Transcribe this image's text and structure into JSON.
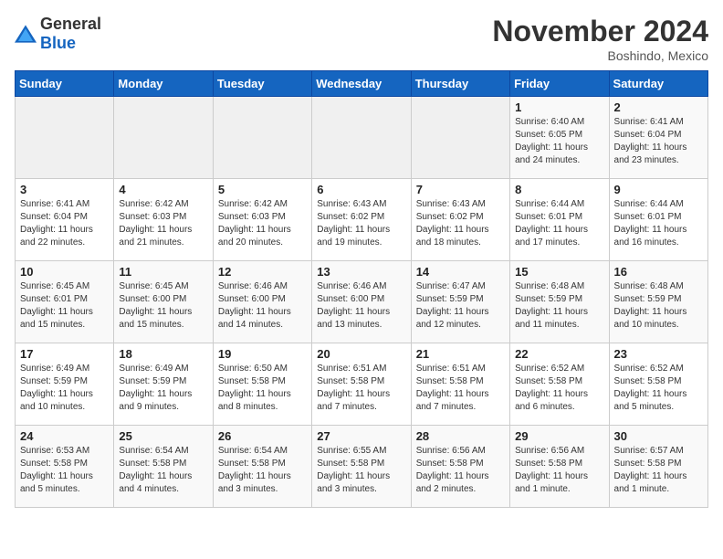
{
  "header": {
    "logo_general": "General",
    "logo_blue": "Blue",
    "month": "November 2024",
    "location": "Boshindo, Mexico"
  },
  "weekdays": [
    "Sunday",
    "Monday",
    "Tuesday",
    "Wednesday",
    "Thursday",
    "Friday",
    "Saturday"
  ],
  "weeks": [
    [
      {
        "day": "",
        "info": ""
      },
      {
        "day": "",
        "info": ""
      },
      {
        "day": "",
        "info": ""
      },
      {
        "day": "",
        "info": ""
      },
      {
        "day": "",
        "info": ""
      },
      {
        "day": "1",
        "info": "Sunrise: 6:40 AM\nSunset: 6:05 PM\nDaylight: 11 hours and 24 minutes."
      },
      {
        "day": "2",
        "info": "Sunrise: 6:41 AM\nSunset: 6:04 PM\nDaylight: 11 hours and 23 minutes."
      }
    ],
    [
      {
        "day": "3",
        "info": "Sunrise: 6:41 AM\nSunset: 6:04 PM\nDaylight: 11 hours and 22 minutes."
      },
      {
        "day": "4",
        "info": "Sunrise: 6:42 AM\nSunset: 6:03 PM\nDaylight: 11 hours and 21 minutes."
      },
      {
        "day": "5",
        "info": "Sunrise: 6:42 AM\nSunset: 6:03 PM\nDaylight: 11 hours and 20 minutes."
      },
      {
        "day": "6",
        "info": "Sunrise: 6:43 AM\nSunset: 6:02 PM\nDaylight: 11 hours and 19 minutes."
      },
      {
        "day": "7",
        "info": "Sunrise: 6:43 AM\nSunset: 6:02 PM\nDaylight: 11 hours and 18 minutes."
      },
      {
        "day": "8",
        "info": "Sunrise: 6:44 AM\nSunset: 6:01 PM\nDaylight: 11 hours and 17 minutes."
      },
      {
        "day": "9",
        "info": "Sunrise: 6:44 AM\nSunset: 6:01 PM\nDaylight: 11 hours and 16 minutes."
      }
    ],
    [
      {
        "day": "10",
        "info": "Sunrise: 6:45 AM\nSunset: 6:01 PM\nDaylight: 11 hours and 15 minutes."
      },
      {
        "day": "11",
        "info": "Sunrise: 6:45 AM\nSunset: 6:00 PM\nDaylight: 11 hours and 15 minutes."
      },
      {
        "day": "12",
        "info": "Sunrise: 6:46 AM\nSunset: 6:00 PM\nDaylight: 11 hours and 14 minutes."
      },
      {
        "day": "13",
        "info": "Sunrise: 6:46 AM\nSunset: 6:00 PM\nDaylight: 11 hours and 13 minutes."
      },
      {
        "day": "14",
        "info": "Sunrise: 6:47 AM\nSunset: 5:59 PM\nDaylight: 11 hours and 12 minutes."
      },
      {
        "day": "15",
        "info": "Sunrise: 6:48 AM\nSunset: 5:59 PM\nDaylight: 11 hours and 11 minutes."
      },
      {
        "day": "16",
        "info": "Sunrise: 6:48 AM\nSunset: 5:59 PM\nDaylight: 11 hours and 10 minutes."
      }
    ],
    [
      {
        "day": "17",
        "info": "Sunrise: 6:49 AM\nSunset: 5:59 PM\nDaylight: 11 hours and 10 minutes."
      },
      {
        "day": "18",
        "info": "Sunrise: 6:49 AM\nSunset: 5:59 PM\nDaylight: 11 hours and 9 minutes."
      },
      {
        "day": "19",
        "info": "Sunrise: 6:50 AM\nSunset: 5:58 PM\nDaylight: 11 hours and 8 minutes."
      },
      {
        "day": "20",
        "info": "Sunrise: 6:51 AM\nSunset: 5:58 PM\nDaylight: 11 hours and 7 minutes."
      },
      {
        "day": "21",
        "info": "Sunrise: 6:51 AM\nSunset: 5:58 PM\nDaylight: 11 hours and 7 minutes."
      },
      {
        "day": "22",
        "info": "Sunrise: 6:52 AM\nSunset: 5:58 PM\nDaylight: 11 hours and 6 minutes."
      },
      {
        "day": "23",
        "info": "Sunrise: 6:52 AM\nSunset: 5:58 PM\nDaylight: 11 hours and 5 minutes."
      }
    ],
    [
      {
        "day": "24",
        "info": "Sunrise: 6:53 AM\nSunset: 5:58 PM\nDaylight: 11 hours and 5 minutes."
      },
      {
        "day": "25",
        "info": "Sunrise: 6:54 AM\nSunset: 5:58 PM\nDaylight: 11 hours and 4 minutes."
      },
      {
        "day": "26",
        "info": "Sunrise: 6:54 AM\nSunset: 5:58 PM\nDaylight: 11 hours and 3 minutes."
      },
      {
        "day": "27",
        "info": "Sunrise: 6:55 AM\nSunset: 5:58 PM\nDaylight: 11 hours and 3 minutes."
      },
      {
        "day": "28",
        "info": "Sunrise: 6:56 AM\nSunset: 5:58 PM\nDaylight: 11 hours and 2 minutes."
      },
      {
        "day": "29",
        "info": "Sunrise: 6:56 AM\nSunset: 5:58 PM\nDaylight: 11 hours and 1 minute."
      },
      {
        "day": "30",
        "info": "Sunrise: 6:57 AM\nSunset: 5:58 PM\nDaylight: 11 hours and 1 minute."
      }
    ]
  ]
}
